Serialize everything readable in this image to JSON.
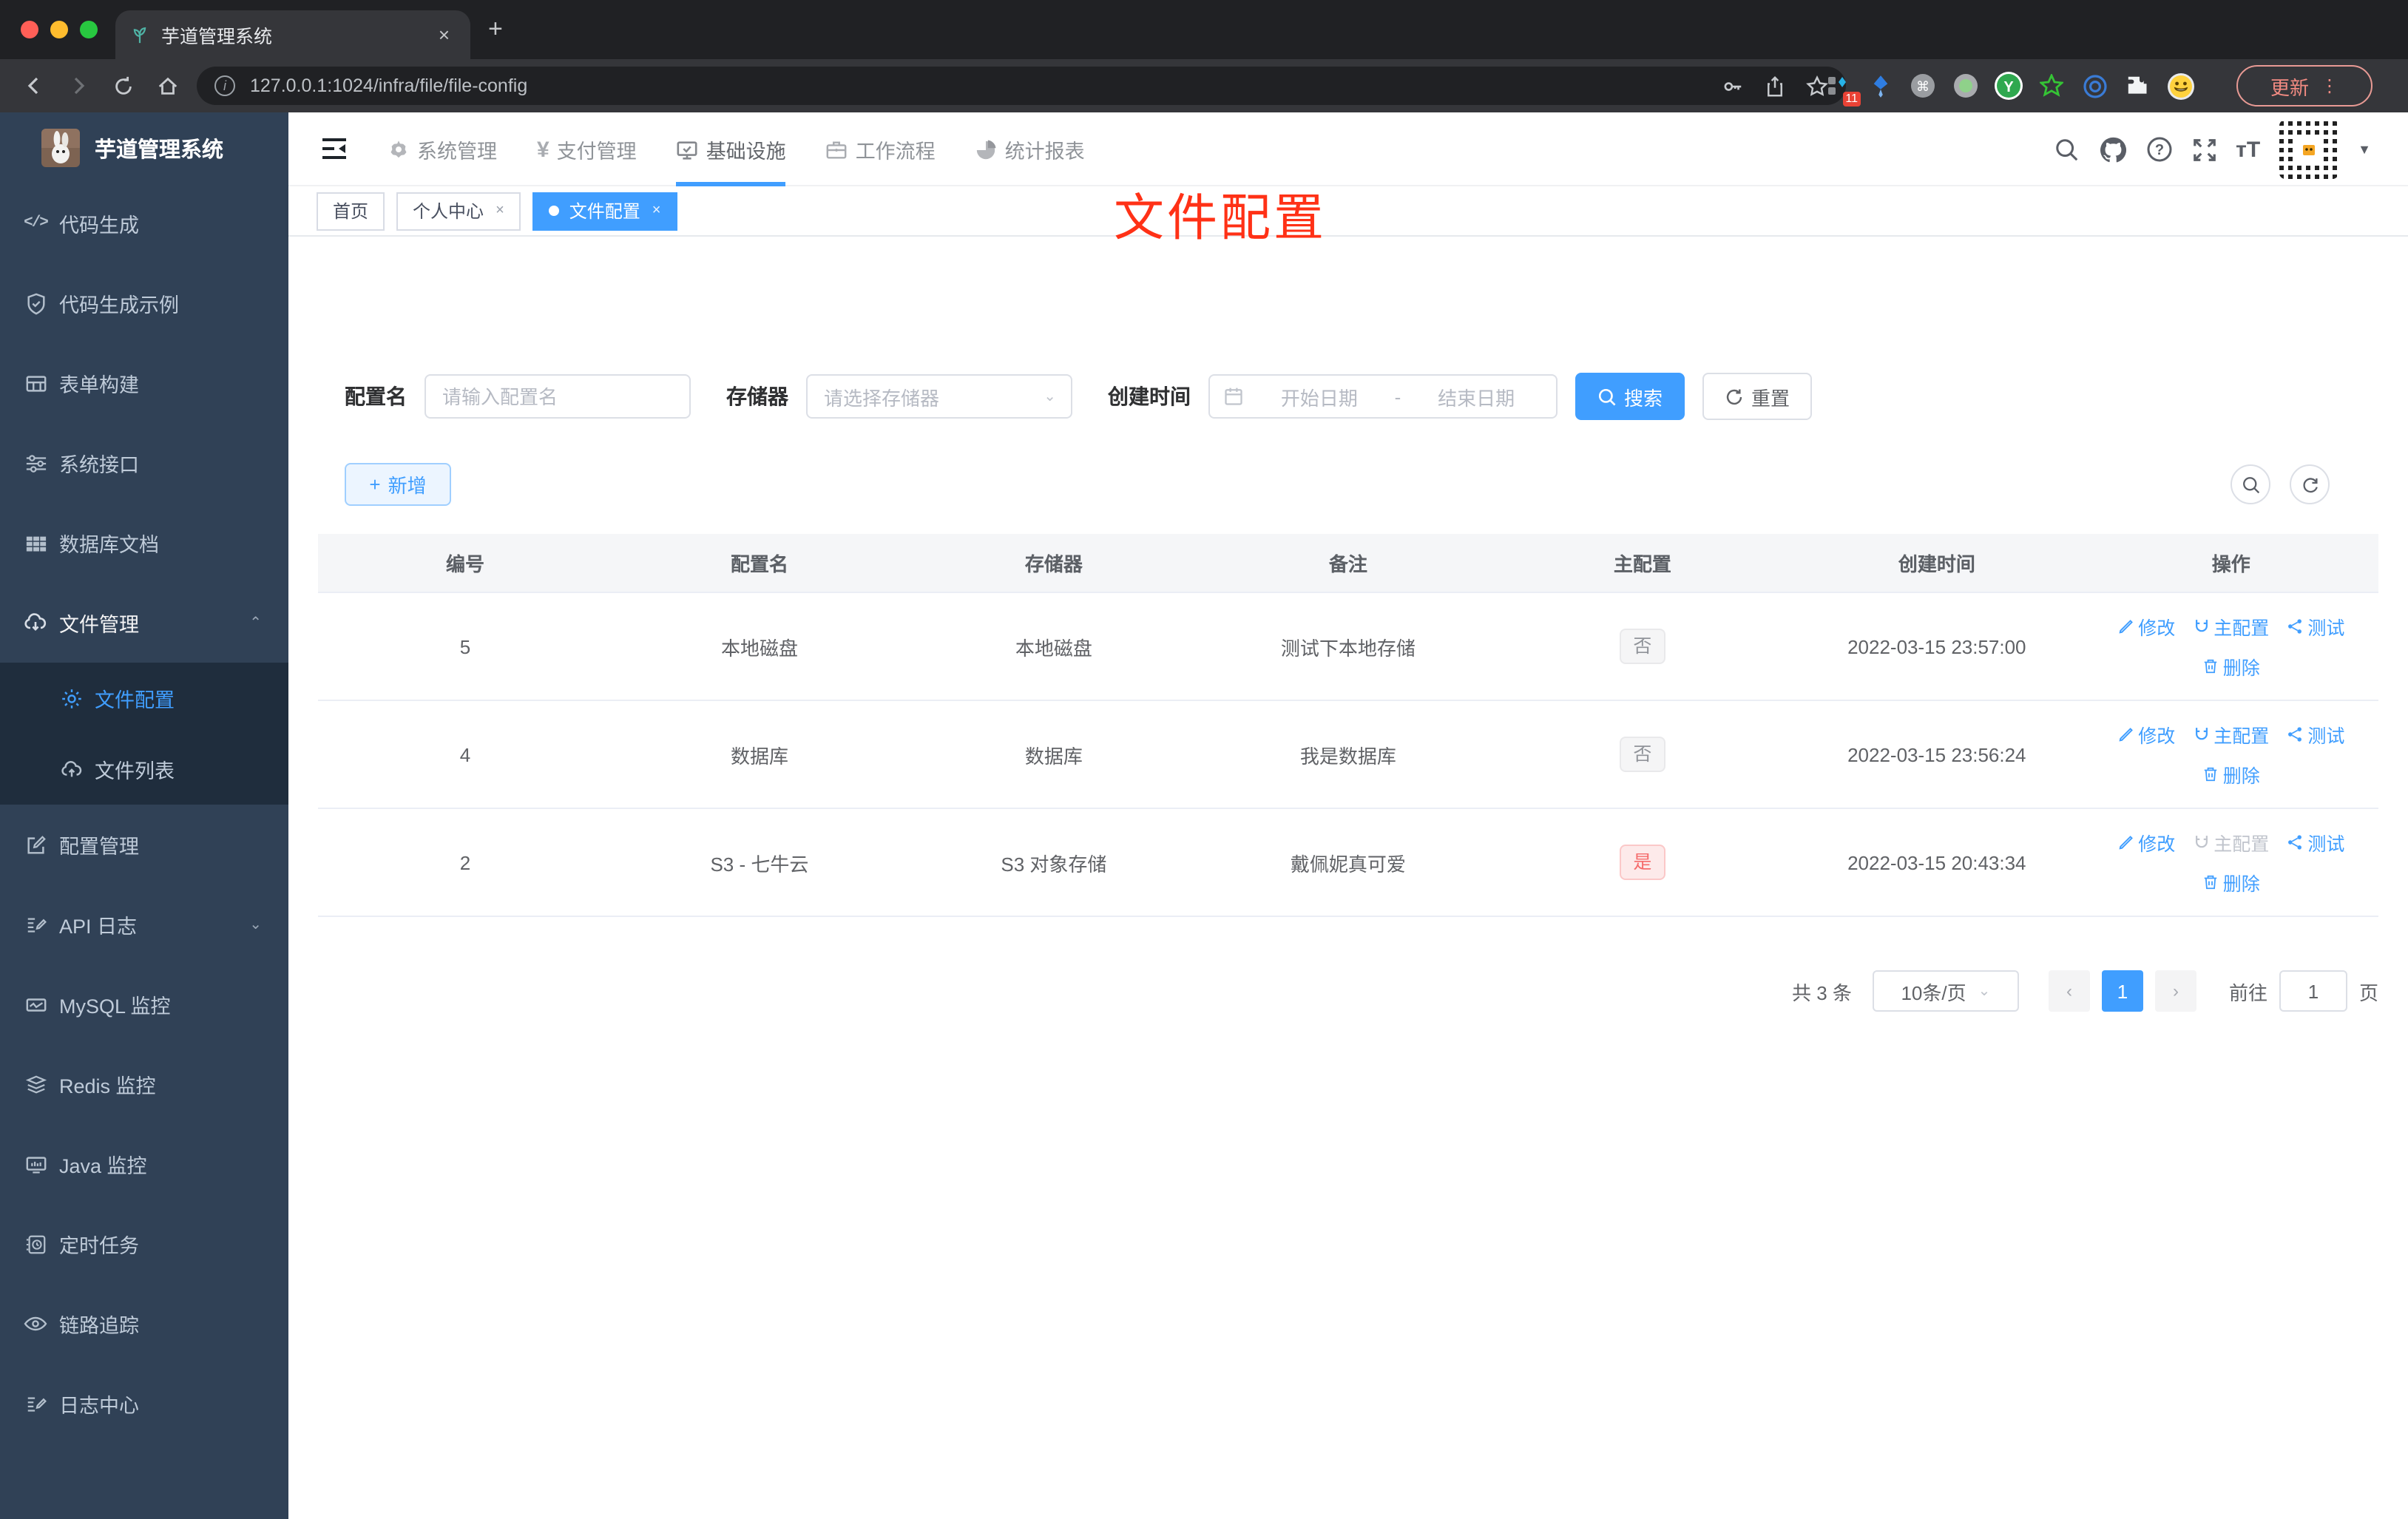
{
  "browser": {
    "tab_title": "芋道管理系统",
    "new_tab_glyph": "+",
    "close_glyph": "×",
    "url": "127.0.0.1:1024/infra/file/file-config",
    "extension_badge": "11",
    "update_button": "更新",
    "menu_dots": "⋮",
    "extension_icon_names": [
      "grid-badge-icon",
      "kite-icon",
      "command-circle-icon",
      "record-circle-icon",
      "y-circle-icon",
      "star-outline-icon",
      "eye-circle-icon",
      "puzzle-icon",
      "emoji-icon"
    ]
  },
  "sidebar": {
    "app_title": "芋道管理系统",
    "items": [
      {
        "label": "代码生成",
        "icon": "code-icon"
      },
      {
        "label": "代码生成示例",
        "icon": "shield-check-icon"
      },
      {
        "label": "表单构建",
        "icon": "form-icon"
      },
      {
        "label": "系统接口",
        "icon": "sliders-icon"
      },
      {
        "label": "数据库文档",
        "icon": "table-grid-icon"
      },
      {
        "label": "文件管理",
        "icon": "cloud-download-icon",
        "expanded": true
      },
      {
        "label": "文件配置",
        "icon": "gear-icon",
        "active": true,
        "sub": true
      },
      {
        "label": "文件列表",
        "icon": "cloud-upload-icon",
        "sub": true
      },
      {
        "label": "配置管理",
        "icon": "edit-square-icon"
      },
      {
        "label": "API 日志",
        "icon": "log-edit-icon",
        "collapsible": true
      },
      {
        "label": "MySQL 监控",
        "icon": "chart-icon"
      },
      {
        "label": "Redis 监控",
        "icon": "layers-icon"
      },
      {
        "label": "Java 监控",
        "icon": "monitor-icon"
      },
      {
        "label": "定时任务",
        "icon": "schedule-icon"
      },
      {
        "label": "链路追踪",
        "icon": "eye-icon"
      },
      {
        "label": "日志中心",
        "icon": "log-edit-icon"
      }
    ]
  },
  "topnav": {
    "items": [
      {
        "label": "系统管理",
        "icon": "gear-icon"
      },
      {
        "label": "支付管理",
        "icon": "yen-icon",
        "glyph": "¥"
      },
      {
        "label": "基础设施",
        "icon": "monitor-check-icon",
        "active": true
      },
      {
        "label": "工作流程",
        "icon": "briefcase-icon"
      },
      {
        "label": "统计报表",
        "icon": "pie-chart-icon"
      }
    ],
    "right_icons": [
      "search-icon",
      "github-icon",
      "help-icon",
      "fullscreen-icon",
      "font-size-icon"
    ],
    "font_size_glyph": "тT"
  },
  "tags": {
    "items": [
      {
        "label": "首页",
        "closable": false,
        "active": false
      },
      {
        "label": "个人中心",
        "closable": true,
        "active": false
      },
      {
        "label": "文件配置",
        "closable": true,
        "active": true
      }
    ],
    "close_glyph": "×"
  },
  "annotation": {
    "text": "文件配置",
    "color": "#ff3116"
  },
  "filter": {
    "config_name_label": "配置名",
    "config_name_placeholder": "请输入配置名",
    "storage_label": "存储器",
    "storage_placeholder": "请选择存储器",
    "create_time_label": "创建时间",
    "start_placeholder": "开始日期",
    "range_separator": "-",
    "end_placeholder": "结束日期",
    "search_label": "搜索",
    "reset_label": "重置"
  },
  "toolbar": {
    "add_label": "新增",
    "plus_glyph": "+"
  },
  "table": {
    "columns": [
      "编号",
      "配置名",
      "存储器",
      "备注",
      "主配置",
      "创建时间",
      "操作"
    ],
    "action_labels": {
      "edit": "修改",
      "master": "主配置",
      "test": "测试",
      "delete": "删除"
    },
    "rows": [
      {
        "id": "5",
        "name": "本地磁盘",
        "storage": "本地磁盘",
        "remark": "测试下本地存储",
        "master": "否",
        "master_type": "info",
        "created": "2022-03-15 23:57:00"
      },
      {
        "id": "4",
        "name": "数据库",
        "storage": "数据库",
        "remark": "我是数据库",
        "master": "否",
        "master_type": "info",
        "created": "2022-03-15 23:56:24"
      },
      {
        "id": "2",
        "name": "S3 - 七牛云",
        "storage": "S3 对象存储",
        "remark": "戴佩妮真可爱",
        "master": "是",
        "master_type": "danger",
        "created": "2022-03-15 20:43:34"
      }
    ]
  },
  "pagination": {
    "total_text": "共 3 条",
    "page_size": "10条/页",
    "prev_glyph": "‹",
    "current_page": "1",
    "next_glyph": "›",
    "goto_label": "前往",
    "goto_value": "1",
    "page_label": "页"
  },
  "colors": {
    "accent": "#409eff",
    "danger": "#f56c6c",
    "sidebar_bg": "#304156",
    "submenu_bg": "#1f2d3d",
    "chrome_dark": "#202124",
    "chrome_toolbar": "#35363a",
    "annotation_red": "#ff3116"
  }
}
